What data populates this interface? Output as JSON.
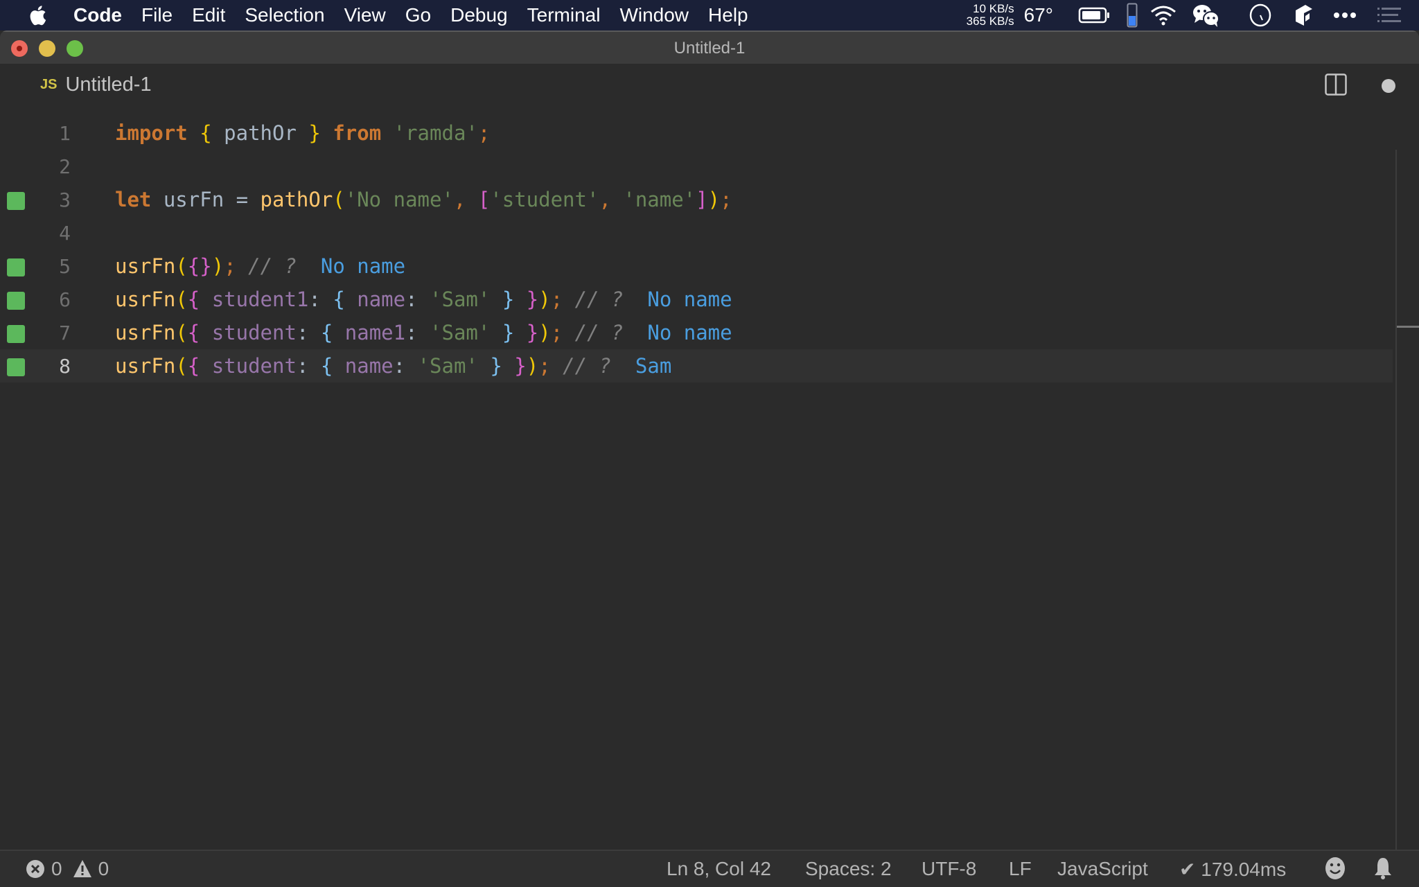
{
  "menubar": {
    "app_name": "Code",
    "items": [
      "File",
      "Edit",
      "Selection",
      "View",
      "Go",
      "Debug",
      "Terminal",
      "Window",
      "Help"
    ],
    "net_up": "10 KB/s",
    "net_down": "365 KB/s",
    "temperature": "67°",
    "tray_icons": [
      "battery-icon",
      "battery-level-icon",
      "wifi-icon",
      "wechat-icon",
      "clock-icon",
      "app-icon",
      "more-icon",
      "notification-center-icon"
    ]
  },
  "window": {
    "title": "Untitled-1"
  },
  "tab": {
    "icon_label": "JS",
    "name": "Untitled-1"
  },
  "editor": {
    "lines": [
      {
        "num": "1",
        "marker": false,
        "current": false
      },
      {
        "num": "2",
        "marker": false,
        "current": false
      },
      {
        "num": "3",
        "marker": true,
        "current": false
      },
      {
        "num": "4",
        "marker": false,
        "current": false
      },
      {
        "num": "5",
        "marker": true,
        "current": false
      },
      {
        "num": "6",
        "marker": true,
        "current": false
      },
      {
        "num": "7",
        "marker": true,
        "current": false
      },
      {
        "num": "8",
        "marker": true,
        "current": true
      }
    ],
    "tokens": {
      "l1": [
        "import",
        " ",
        "{",
        " pathOr ",
        "}",
        " ",
        "from",
        " ",
        "'ramda'",
        ";"
      ],
      "l3": [
        "let",
        " usrFn = ",
        "pathOr",
        "(",
        "'No name'",
        ", ",
        "[",
        "'student'",
        ", ",
        "'name'",
        "]",
        ")",
        ";"
      ],
      "l5": [
        "usrFn",
        "(",
        "{",
        "}",
        ")",
        ";",
        " // ?  ",
        "No name"
      ],
      "l6": [
        "usrFn",
        "(",
        "{",
        " ",
        "student1",
        ": ",
        "{",
        " ",
        "name",
        ": ",
        "'Sam'",
        " ",
        "}",
        " ",
        "}",
        ")",
        ";",
        " // ?  ",
        "No name"
      ],
      "l7": [
        "usrFn",
        "(",
        "{",
        " ",
        "student",
        ": ",
        "{",
        " ",
        "name1",
        ": ",
        "'Sam'",
        " ",
        "}",
        " ",
        "}",
        ")",
        ";",
        " // ?  ",
        "No name"
      ],
      "l8": [
        "usrFn",
        "(",
        "{",
        " ",
        "student",
        ": ",
        "{",
        " ",
        "name",
        ": ",
        "'Sam'",
        " ",
        "}",
        " ",
        "}",
        ")",
        ";",
        " // ?  ",
        "Sam"
      ]
    }
  },
  "statusbar": {
    "errors": "0",
    "warnings": "0",
    "cursor": "Ln 8, Col 42",
    "indent": "Spaces: 2",
    "encoding": "UTF-8",
    "eol": "LF",
    "language": "JavaScript",
    "timing": "✔ 179.04ms"
  }
}
